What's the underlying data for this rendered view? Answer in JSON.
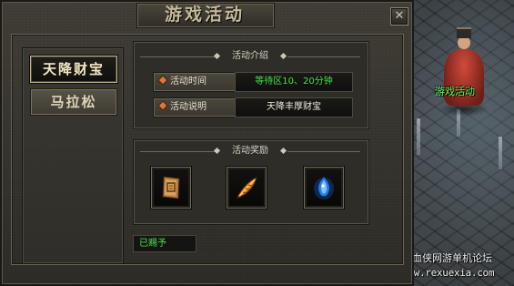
{
  "dialog": {
    "title": "游戏活动",
    "close_label": "✕"
  },
  "tabs": [
    {
      "label": "天降财宝",
      "selected": true
    },
    {
      "label": "马拉松",
      "selected": false
    }
  ],
  "info": {
    "section_title": "活动介绍",
    "rows": [
      {
        "label": "活动时间",
        "value": "等待区10、20分钟",
        "value_color": "#43e04a"
      },
      {
        "label": "活动说明",
        "value": "天降丰厚财宝",
        "value_color": "#f2ecdd"
      }
    ]
  },
  "rewards": {
    "section_title": "活动奖励",
    "items": [
      {
        "icon": "scroll-icon"
      },
      {
        "icon": "feather-icon"
      },
      {
        "icon": "blue-crystal-icon"
      }
    ]
  },
  "status": {
    "text": "已赐予",
    "color": "#4fe050"
  },
  "world": {
    "npc_label": "游戏活动",
    "npc_label_color": "#5cff5c",
    "watermark_line1": "热血侠网游单机论坛",
    "watermark_line2": "www.rexuexia.com"
  }
}
